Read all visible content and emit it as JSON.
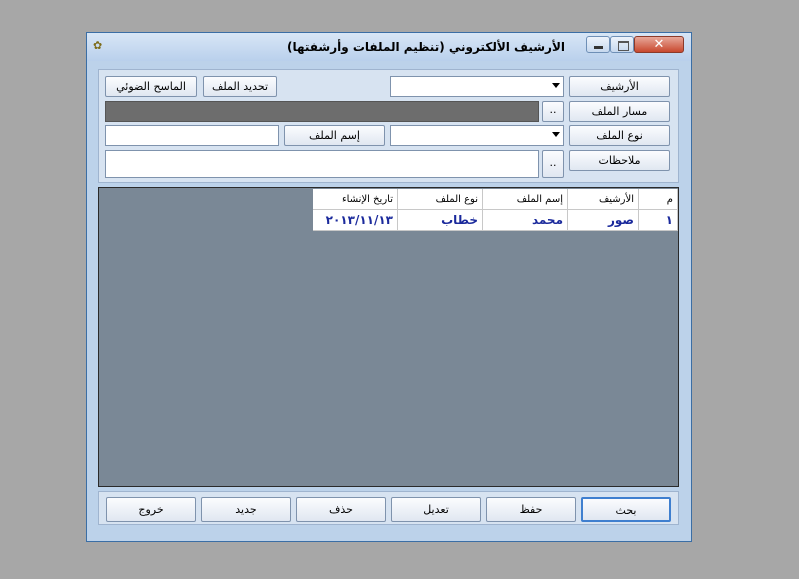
{
  "window": {
    "title": "الأرشيف الألكتروني (تنظيم الملفات وأرشفتها)",
    "close_glyph": "✕"
  },
  "form": {
    "archive_label": "الأرشيف",
    "archive_value": "",
    "path_label": "مسار الملف",
    "path_value": "",
    "filetype_label": "نوع الملف",
    "filetype_value": "",
    "notes_label": "ملاحظات",
    "notes_value": "",
    "browse_label": "..",
    "filename_label": "إسم الملف",
    "filename_value": "",
    "select_file_label": "تحديد الملف",
    "scanner_label": "الماسح الضوئي"
  },
  "grid": {
    "columns": [
      "م",
      "الأرشيف",
      "إسم الملف",
      "نوع الملف",
      "تاريخ الإنشاء"
    ],
    "rows": [
      [
        "١",
        "صور",
        "محمد",
        "خطاب",
        "٢٠١٣/١١/١٣"
      ]
    ]
  },
  "actions": {
    "search": "بحث",
    "save": "حفظ",
    "edit": "تعديل",
    "delete": "حذف",
    "new": "جديد",
    "exit": "خروج"
  }
}
